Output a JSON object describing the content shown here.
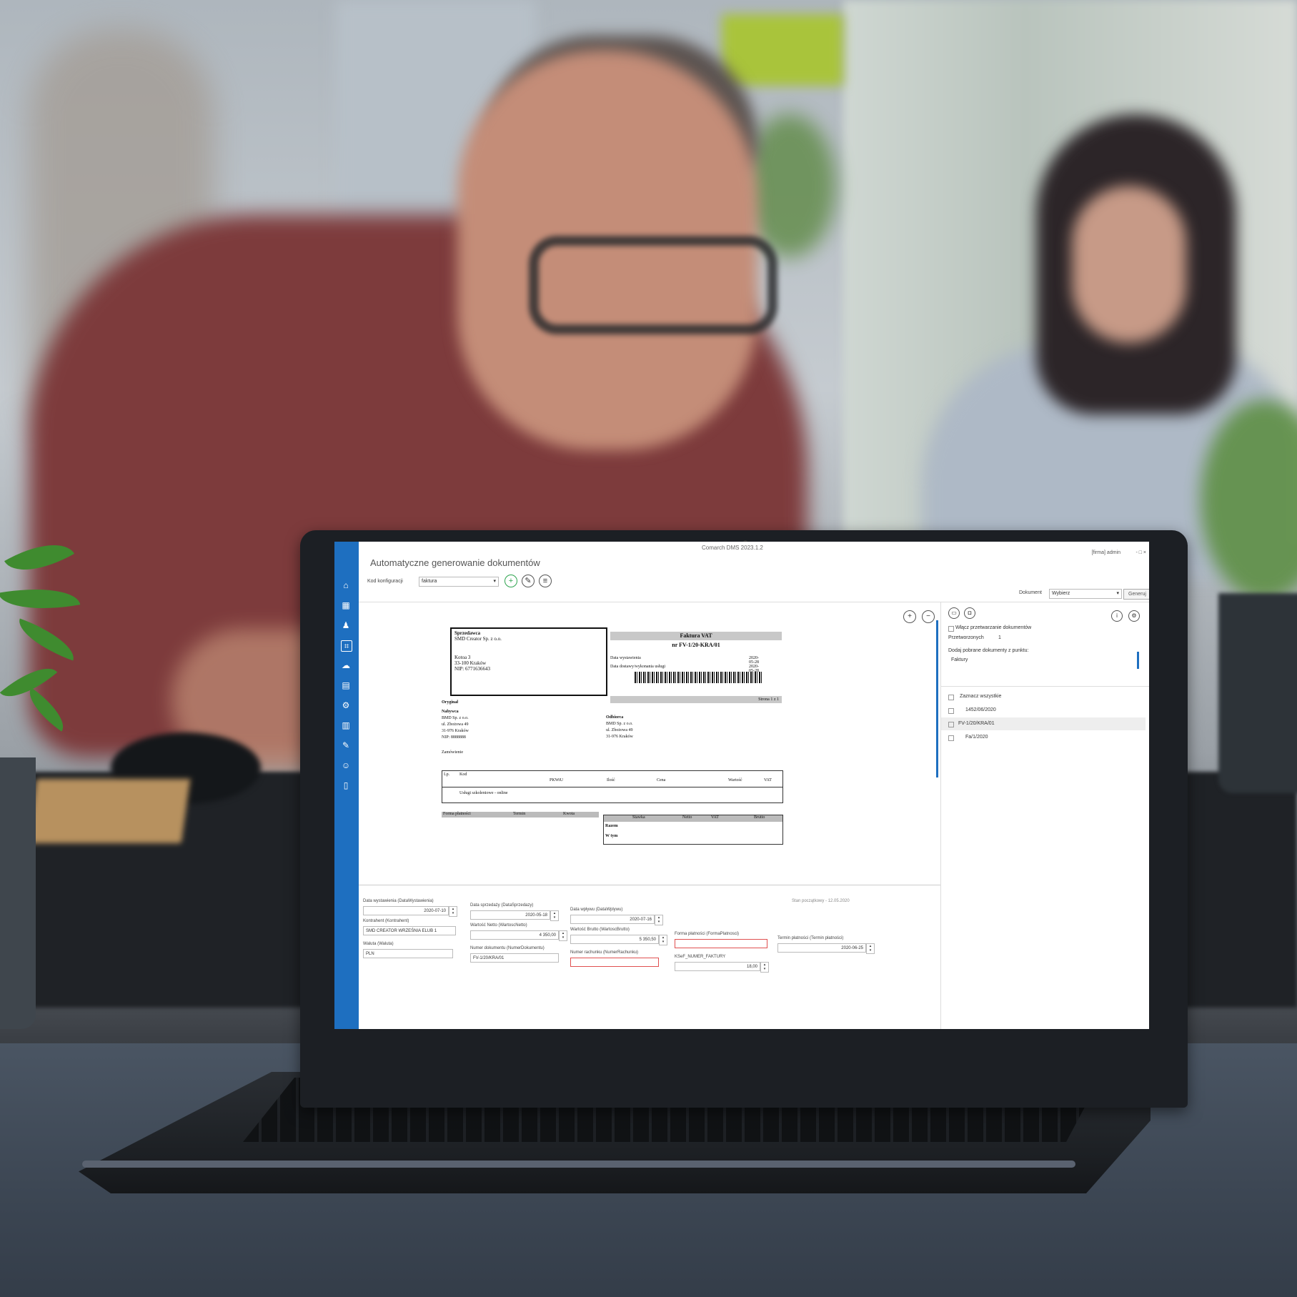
{
  "app": {
    "window_title": "Comarch DMS 2023.1.2",
    "user": "[firma]  admin",
    "window_controls": "- □ ×",
    "page_heading": "Automatyczne generowanie dokumentów"
  },
  "toolbar": {
    "config_label": "Kod konfiguracji",
    "config_value": "faktura",
    "add_icon": "plus-icon",
    "edit_icon": "pencil-icon",
    "delete_icon": "trash-icon",
    "document_label": "Dokument",
    "document_value": "Wybierz",
    "generate_label": "Generuj"
  },
  "sidebar": {
    "items": [
      "home-icon",
      "grid-icon",
      "user-icon",
      "scan-icon",
      "cloud-icon",
      "document-icon",
      "gear-icon",
      "chart-icon",
      "pen-icon",
      "users-icon",
      "exit-icon"
    ]
  },
  "invoice": {
    "seller_label": "Sprzedawca",
    "seller_name": "SMD Creator Sp. z o.o.",
    "seller_street": "Kotoa 3",
    "seller_city": "33-100 Kraków",
    "seller_nip": "NIP: 6771636643",
    "title": "Faktura VAT",
    "number": "nr FV-1/20-KRA/01",
    "issue_date_label": "Data wystawienia",
    "issue_date": "2020-05-28",
    "sale_date_label": "Data dostawy/wykonania usługi",
    "sale_date": "2020-05-28",
    "pages": "Strona 1 z 1",
    "original": "Oryginał",
    "buyer_label": "Nabywca",
    "buyer_name": "BMD Sp. z o.o.",
    "buyer_street": "ul. Zbożowa 49",
    "buyer_city": "31-976 Kraków",
    "buyer_nip": "NIP: 8888888",
    "recipient_label": "Odbiorca",
    "recipient_name": "BMD Sp. z o.o.",
    "recipient_street": "ul. Zbożowa 49",
    "recipient_city": "31-976 Kraków",
    "order_label": "Zamówienie",
    "table_headers": [
      "Lp.",
      "Kod",
      "PKWiU",
      "Ilość",
      "Cena",
      "Wartość",
      "VAT"
    ],
    "table_row": "Usługi szkoleniowe - online",
    "payment_label": "Forma płatności",
    "payment_term": "Termin",
    "payment_amount": "Kwota",
    "sum_headers": [
      "Stawka",
      "Netto",
      "VAT",
      "Brutto"
    ],
    "sum_row1": "Razem",
    "sum_row2": "W tym"
  },
  "right_panel": {
    "option1": "Włącz przetwarzanie dokumentów",
    "option2": "Przetworzonych",
    "option2_value": "1",
    "option3": "Dodaj pobrane dokumenty z punktu:",
    "option3_value": "Faktury",
    "tree_header": "Zaznacz wszystkie",
    "tree_items": [
      "1452/06/2020",
      "FV-1/20/KRA/01",
      "Fa/1/2020"
    ]
  },
  "form": {
    "status_text": "Stan początkowy - 12.05.2020",
    "issue_date_label": "Data wystawienia (DataWystawienia)",
    "issue_date": "2020-07-10",
    "sale_date_label": "Data sprzedaży (DataSprzedazy)",
    "sale_date": "2020-05-18",
    "receipt_date_label": "Data wpływu (DataWplywu)",
    "receipt_date": "2020-07-16",
    "contractor_label": "Kontrahent (Kontrahent)",
    "contractor_value": "SMD CREATOR WRZEŚNIA ELUB 1",
    "net_label": "Wartość Netto (WartoscNetto)",
    "net_value": "4 350,00",
    "gross_label": "Wartość Brutto (WartoscBrutto)",
    "gross_value": "5 350,50",
    "payment_label": "Forma płatności (FormaPlatnosci)",
    "payment_value": "",
    "due_label": "Termin płatności (Termin płatności)",
    "due_value": "2020-06-25",
    "currency_label": "Waluta (Waluta)",
    "currency_value": "PLN",
    "docnum_label": "Numer dokumentu (NumerDokumentu)",
    "docnum_value": "FV-1/20/KRA/01",
    "bank_label": "Numer rachunku (NumerRachunku)",
    "bank_value": "",
    "ksef_label": "KSeF_NUMER_FAKTURY",
    "ksef_value": "18,00"
  }
}
